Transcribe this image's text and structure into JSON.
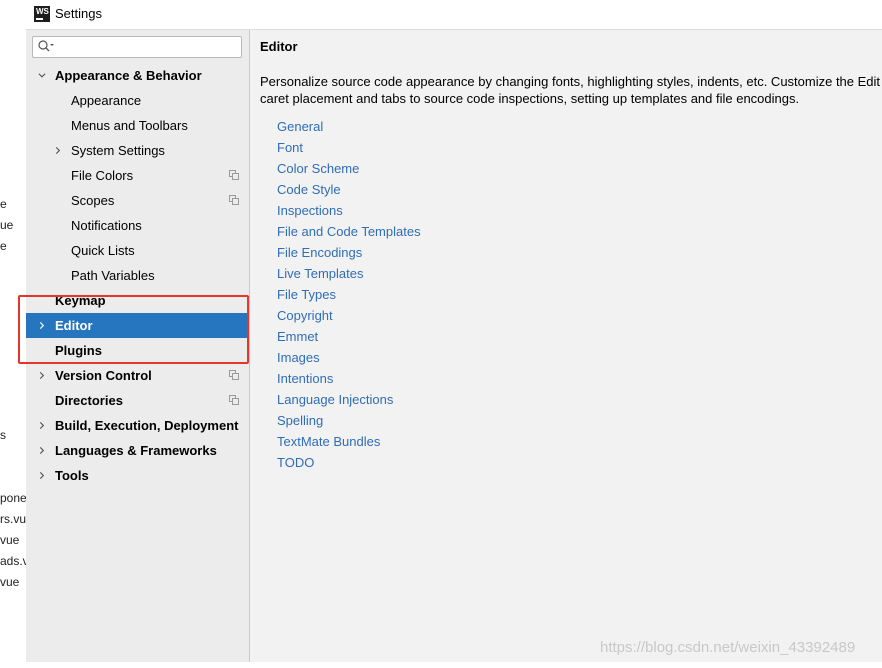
{
  "window": {
    "title": "Settings",
    "logo": "WS"
  },
  "background_editor": {
    "lines": [
      "e",
      "ue",
      "e",
      "s",
      "pone",
      "rs.vue",
      "vue",
      "ads.v",
      "vue"
    ]
  },
  "search": {
    "placeholder": "",
    "value": ""
  },
  "sidebar": {
    "items": [
      {
        "label": "Appearance & Behavior",
        "bold": true,
        "expanded": true
      },
      {
        "label": "Appearance"
      },
      {
        "label": "Menus and Toolbars"
      },
      {
        "label": "System Settings",
        "has_children": true
      },
      {
        "label": "File Colors",
        "copy_icon": true
      },
      {
        "label": "Scopes",
        "copy_icon": true
      },
      {
        "label": "Notifications"
      },
      {
        "label": "Quick Lists"
      },
      {
        "label": "Path Variables"
      },
      {
        "label": "Keymap",
        "bold": true
      },
      {
        "label": "Editor",
        "bold": true,
        "selected": true,
        "has_children": true
      },
      {
        "label": "Plugins",
        "bold": true
      },
      {
        "label": "Version Control",
        "bold": true,
        "has_children": true,
        "copy_icon": true
      },
      {
        "label": "Directories",
        "bold": true,
        "copy_icon": true
      },
      {
        "label": "Build, Execution, Deployment",
        "bold": true,
        "has_children": true
      },
      {
        "label": "Languages & Frameworks",
        "bold": true,
        "has_children": true
      },
      {
        "label": "Tools",
        "bold": true,
        "has_children": true
      }
    ]
  },
  "content": {
    "title": "Editor",
    "description_line1": "Personalize source code appearance by changing fonts, highlighting styles, indents, etc. Customize the Edit",
    "description_line2": "caret placement and tabs to source code inspections, setting up templates and file encodings.",
    "links": [
      "General",
      "Font",
      "Color Scheme",
      "Code Style",
      "Inspections",
      "File and Code Templates",
      "File Encodings",
      "Live Templates",
      "File Types",
      "Copyright",
      "Emmet",
      "Images",
      "Intentions",
      "Language Injections",
      "Spelling",
      "TextMate Bundles",
      "TODO"
    ]
  },
  "watermark": "https://blog.csdn.net/weixin_43392489",
  "colors": {
    "accent": "#2675bf",
    "link": "#2f6db5",
    "highlight_box": "#e8352b",
    "sidebar_bg": "#ececec",
    "content_bg": "#f2f2f2"
  }
}
